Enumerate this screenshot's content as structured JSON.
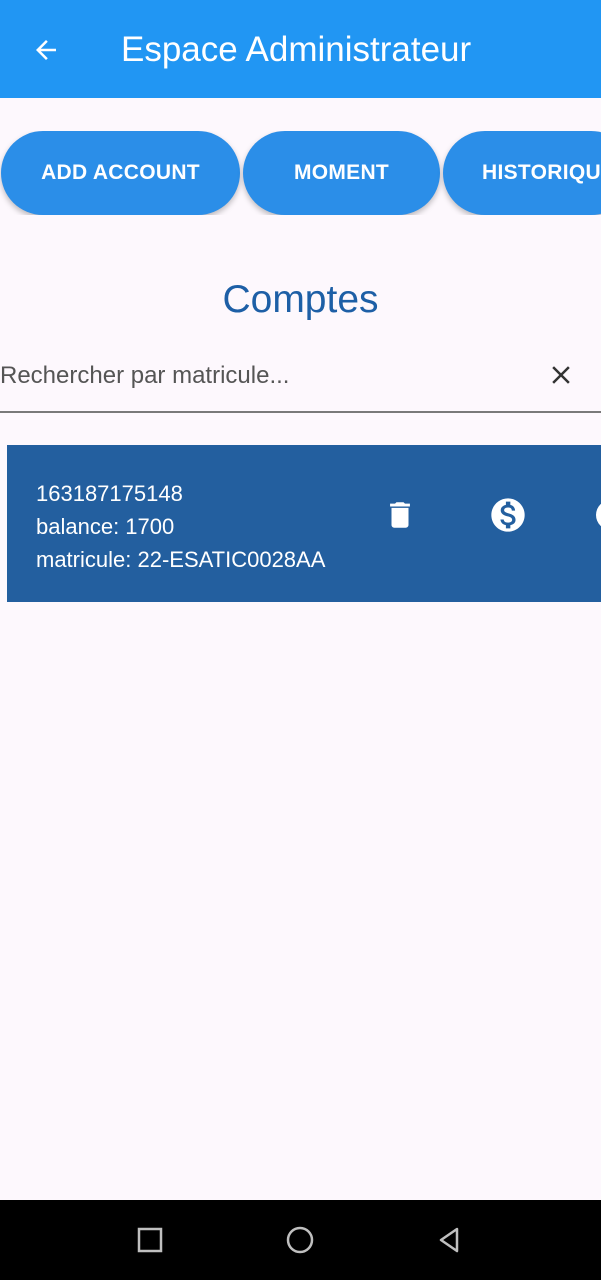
{
  "app_bar": {
    "title": "Espace Administrateur",
    "background": "#2196f3",
    "back_icon": "arrow-back-icon"
  },
  "actions": [
    {
      "label": "ADD ACCOUNT"
    },
    {
      "label": "MOMENT"
    },
    {
      "label": "HISTORIQUE"
    }
  ],
  "section_title": "Comptes",
  "search": {
    "placeholder": "Rechercher par matricule...",
    "value": "",
    "clear_icon": "close-icon"
  },
  "accounts": [
    {
      "number": "163187175148",
      "balance": "balance: 1700",
      "matricule": "matricule: 22-ESATIC0028AA",
      "icons": [
        "delete-icon",
        "dollar-icon",
        "more-icon"
      ]
    }
  ],
  "nav_bar": {
    "icons": [
      "recent-apps-icon",
      "home-icon",
      "back-triangle-icon"
    ]
  },
  "colors": {
    "accent": "#2196f3",
    "button": "#2b8ee8",
    "card": "#235f9f",
    "title": "#1d5fa6"
  }
}
